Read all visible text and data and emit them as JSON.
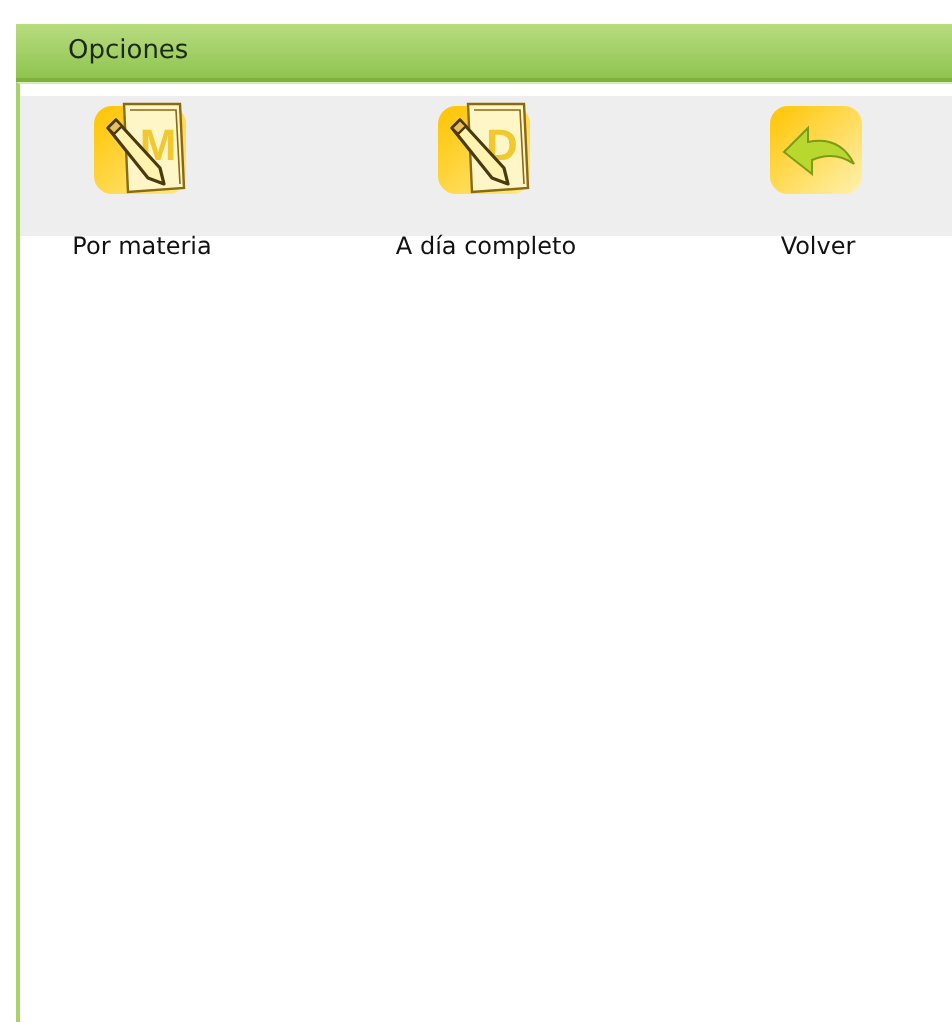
{
  "header": {
    "title": "Opciones"
  },
  "options": [
    {
      "kind": "document",
      "letter": "M",
      "label": "Por materia"
    },
    {
      "kind": "document",
      "letter": "D",
      "label": "A día completo"
    },
    {
      "kind": "back",
      "label": "Volver"
    }
  ]
}
